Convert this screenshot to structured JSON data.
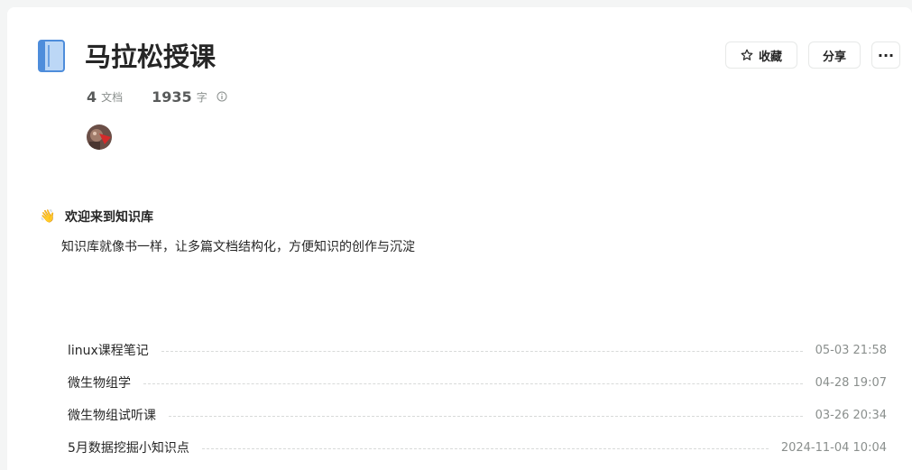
{
  "book": {
    "title": "马拉松授课",
    "icon": "book-icon",
    "doc_count": "4",
    "doc_unit": "文档",
    "word_count": "1935",
    "word_unit": "字"
  },
  "actions": {
    "favorite_label": "收藏",
    "share_label": "分享",
    "more_label": "···"
  },
  "welcome": {
    "icon": "waving-hand-icon",
    "title": "欢迎来到知识库",
    "description": "知识库就像书一样，让多篇文档结构化，方便知识的创作与沉淀"
  },
  "documents": [
    {
      "title": "linux课程笔记",
      "time": "05-03 21:58"
    },
    {
      "title": "微生物组学",
      "time": "04-28 19:07"
    },
    {
      "title": "微生物组试听课",
      "time": "03-26 20:34"
    },
    {
      "title": "5月数据挖掘小知识点",
      "time": "2024-11-04 10:04"
    }
  ],
  "colors": {
    "accent": "#4e8ddb",
    "text": "#262626",
    "muted": "#8a8f8d"
  }
}
